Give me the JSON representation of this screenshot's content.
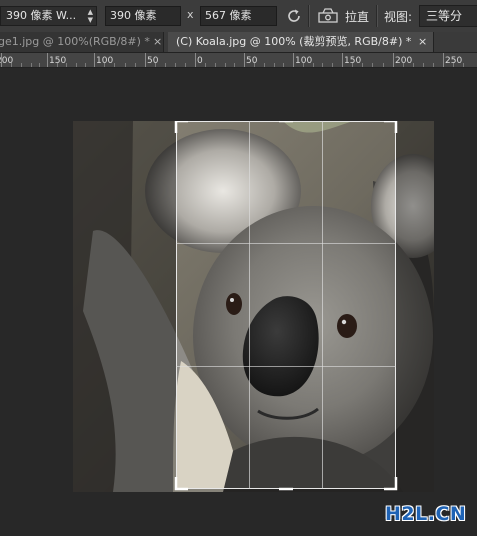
{
  "options_bar": {
    "ratio_preset": "390 像素 W...",
    "width_value": "390 像素",
    "separator": "x",
    "height_value": "567 像素",
    "straighten_label": "拉直",
    "view_label": "视图:",
    "view_value": "三等分"
  },
  "tabs": [
    {
      "label": "ge1.jpg @ 100%(RGB/8#) *",
      "close": "×",
      "active": false
    },
    {
      "label": "(C) Koala.jpg @ 100% (裁剪预览, RGB/8#) *",
      "close": "×",
      "active": true
    }
  ],
  "ruler": {
    "labels": [
      "200",
      "150",
      "100",
      "50",
      "0",
      "50",
      "100",
      "150",
      "200",
      "250"
    ]
  },
  "watermark": "H2L.CN",
  "icons": {
    "rotate": "rotate-icon",
    "straighten": "straighten-icon",
    "dropdown": "chevron-updown-icon"
  },
  "colors": {
    "canvas_bg": "#282828",
    "options_bg": "#3c3c3c",
    "watermark": "#1f63b5"
  }
}
